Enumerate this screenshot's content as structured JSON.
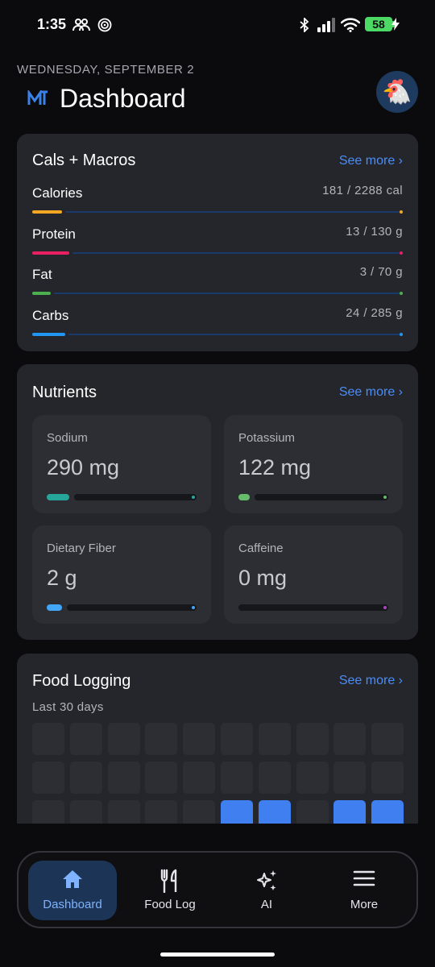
{
  "status_bar": {
    "time": "1:35",
    "battery": "58"
  },
  "header": {
    "date": "WEDNESDAY, SEPTEMBER 2",
    "title": "Dashboard",
    "avatar": "🐔"
  },
  "macros": {
    "title": "Cals + Macros",
    "see_more": "See more ›",
    "items": [
      {
        "name": "Calories",
        "value": "181 / 2288 cal",
        "fraction": 0.08,
        "color": "#f5a623"
      },
      {
        "name": "Protein",
        "value": "13 / 130 g",
        "fraction": 0.1,
        "color": "#e91e63"
      },
      {
        "name": "Fat",
        "value": "3 / 70 g",
        "fraction": 0.05,
        "color": "#4caf50"
      },
      {
        "name": "Carbs",
        "value": "24 / 285 g",
        "fraction": 0.09,
        "color": "#2196f3"
      }
    ]
  },
  "nutrients": {
    "title": "Nutrients",
    "see_more": "See more ›",
    "items": [
      {
        "label": "Sodium",
        "value": "290 mg",
        "fraction": 0.15,
        "color": "#26a69a"
      },
      {
        "label": "Potassium",
        "value": "122 mg",
        "fraction": 0.05,
        "color": "#66bb6a"
      },
      {
        "label": "Dietary Fiber",
        "value": "2 g",
        "fraction": 0.1,
        "color": "#42a5f5"
      },
      {
        "label": "Caffeine",
        "value": "0 mg",
        "fraction": 0.0,
        "color": "#ab47bc"
      }
    ]
  },
  "food_logging": {
    "title": "Food Logging",
    "see_more": "See more ›",
    "subtitle": "Last 30 days",
    "logged_cells": [
      25,
      26,
      28,
      29
    ]
  },
  "bottom_nav": {
    "items": [
      {
        "label": "Dashboard",
        "icon": "home-icon",
        "active": true
      },
      {
        "label": "Food Log",
        "icon": "fork-knife-icon",
        "active": false
      },
      {
        "label": "AI",
        "icon": "sparkle-icon",
        "active": false
      },
      {
        "label": "More",
        "icon": "menu-icon",
        "active": false
      }
    ]
  }
}
